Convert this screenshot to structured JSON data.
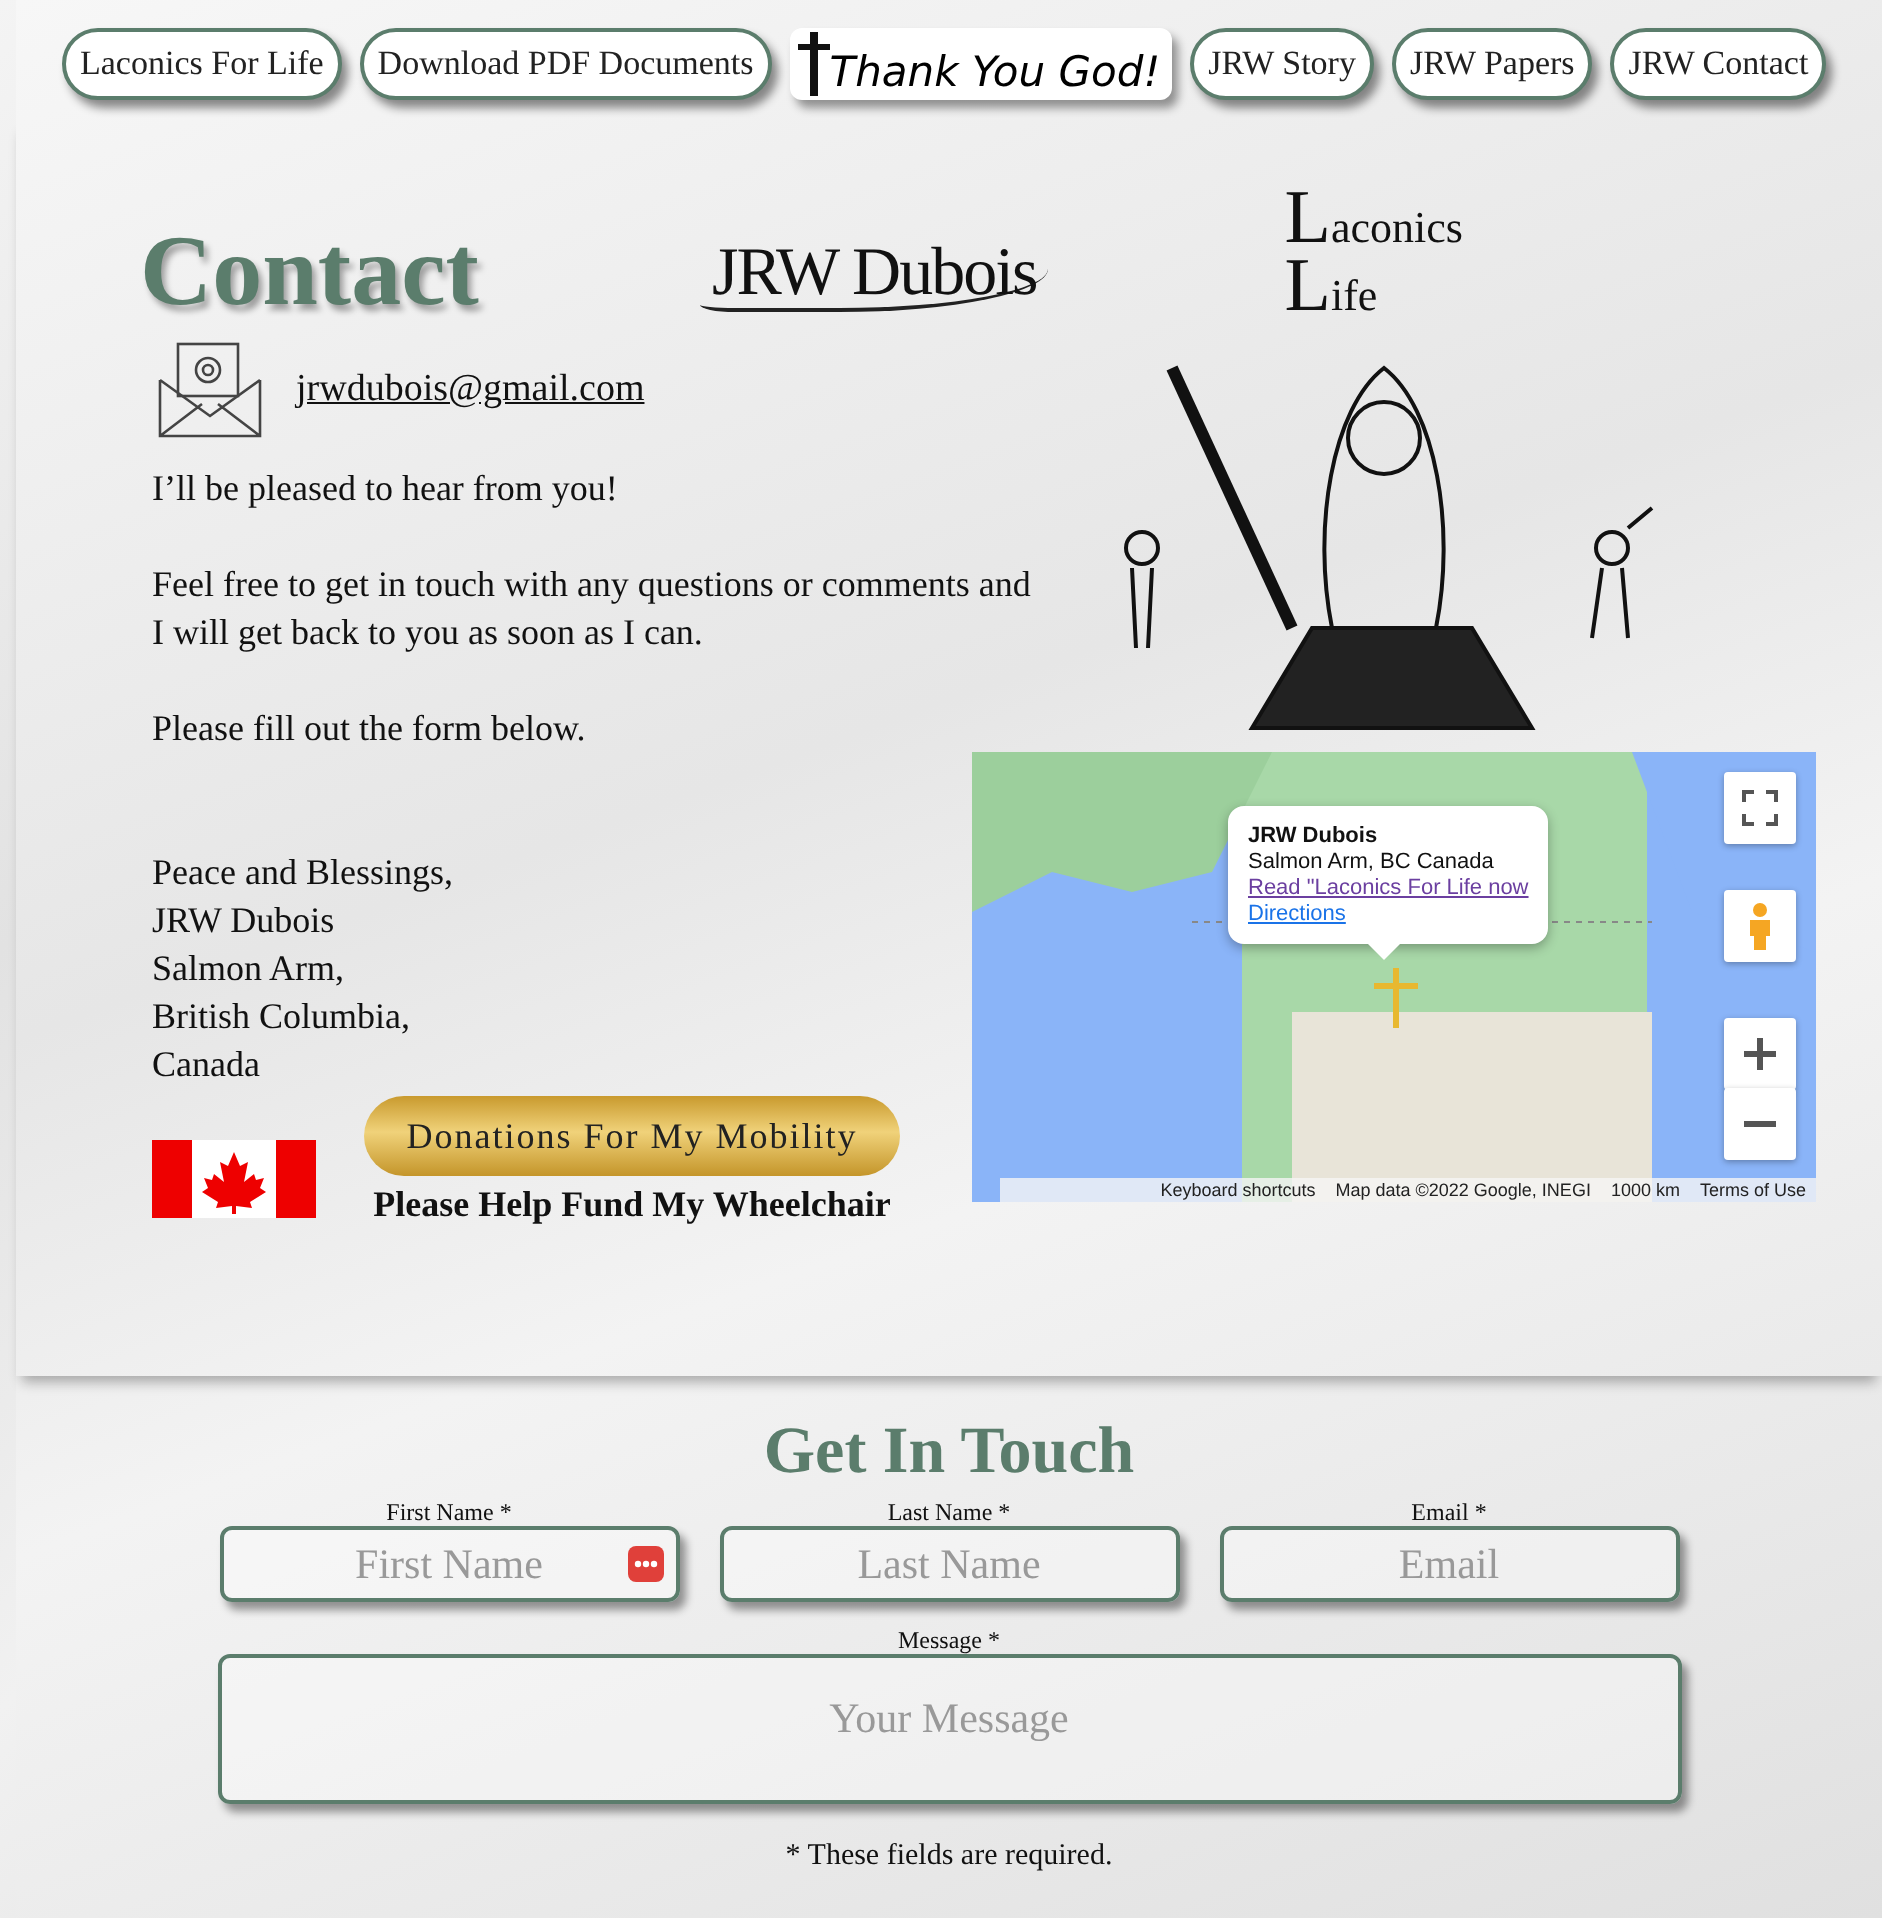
{
  "nav": [
    {
      "label": "Laconics For Life",
      "kind": "pill"
    },
    {
      "label": "Download PDF Documents",
      "kind": "pill"
    },
    {
      "label": "Thank You God!",
      "kind": "script"
    },
    {
      "label": "JRW Story",
      "kind": "pill"
    },
    {
      "label": "JRW Papers",
      "kind": "pill"
    },
    {
      "label": "JRW Contact",
      "kind": "pill"
    }
  ],
  "contact": {
    "heading": "Contact",
    "logo_1": "JRW Dubois",
    "logo_2": [
      "Laconics",
      "Life"
    ],
    "email": "jrwdubois@gmail.com",
    "paragraphs": [
      "I’ll be pleased to hear from you!",
      "Feel free to get in touch with any questions or comments and I will get back to you as soon as I can.",
      "Please fill out the form below."
    ],
    "signature": [
      "Peace and Blessings,",
      "JRW Dubois",
      "Salmon Arm,",
      "British Columbia,",
      "Canada"
    ],
    "donate_button": "Donations For My Mobility",
    "donate_caption": "Please Help Fund My Wheelchair"
  },
  "map": {
    "info_title": "JRW Dubois",
    "info_address": "Salmon Arm, BC Canada",
    "info_link": "Read \"Laconics For Life now",
    "info_directions": "Directions",
    "attribution": [
      "Keyboard shortcuts",
      "Map data ©2022 Google, INEGI",
      "1000 km",
      "Terms of Use"
    ]
  },
  "form": {
    "heading": "Get In Touch",
    "fields": [
      {
        "label": "First Name *",
        "placeholder": "First Name",
        "autofill_icon": true
      },
      {
        "label": "Last Name *",
        "placeholder": "Last Name",
        "autofill_icon": false
      },
      {
        "label": "Email *",
        "placeholder": "Email",
        "autofill_icon": false
      }
    ],
    "message": {
      "label": "Message *",
      "placeholder": "Your Message"
    },
    "note": "* These fields are required."
  }
}
